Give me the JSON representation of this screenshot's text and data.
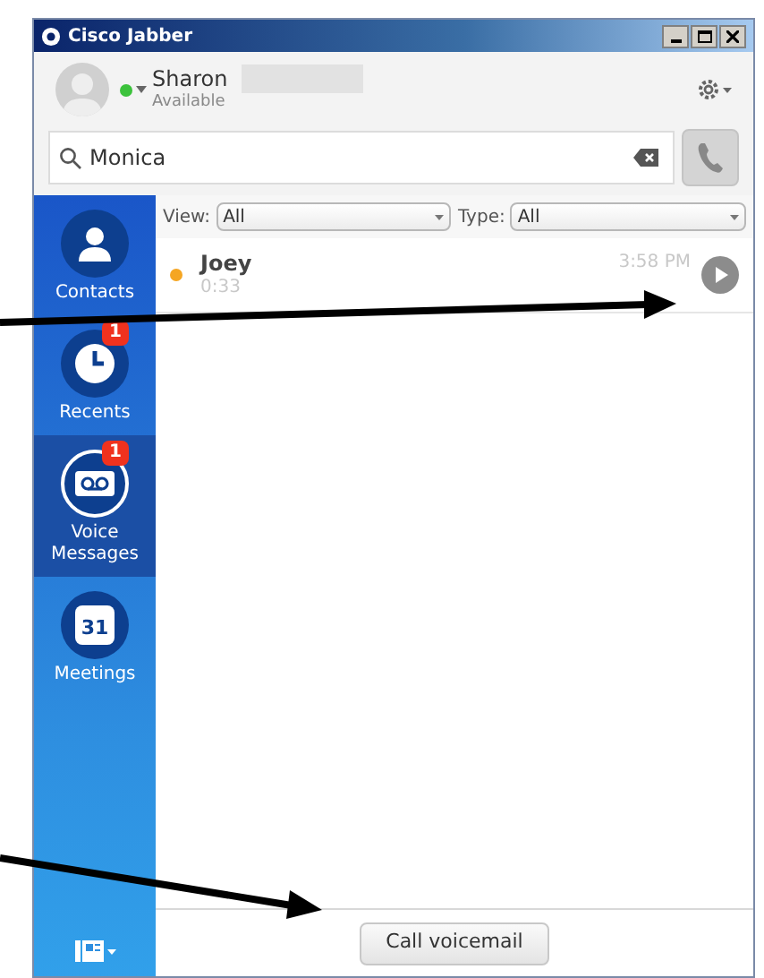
{
  "window": {
    "title": "Cisco Jabber"
  },
  "user": {
    "name": "Sharon",
    "presence": "Available",
    "color": "#3cc23c"
  },
  "search": {
    "value": "Monica"
  },
  "filters": [
    {
      "label": "View:",
      "value": "All"
    },
    {
      "label": "Type:",
      "value": "All"
    }
  ],
  "sidebar": {
    "items": [
      {
        "kind": "contacts",
        "label": "Contacts",
        "selected": false
      },
      {
        "kind": "recents",
        "label": "Recents",
        "badge": "1",
        "selected": false
      },
      {
        "kind": "voicemail",
        "label": "Voice Messages",
        "badge": "1",
        "selected": true
      },
      {
        "kind": "meetings",
        "label": "Meetings",
        "day": "31",
        "selected": false
      }
    ]
  },
  "messages": [
    {
      "name": "Joey",
      "duration": "0:33",
      "time": "3:58 PM",
      "color": "#f5a623"
    }
  ],
  "footer": {
    "button": "Call voicemail"
  }
}
